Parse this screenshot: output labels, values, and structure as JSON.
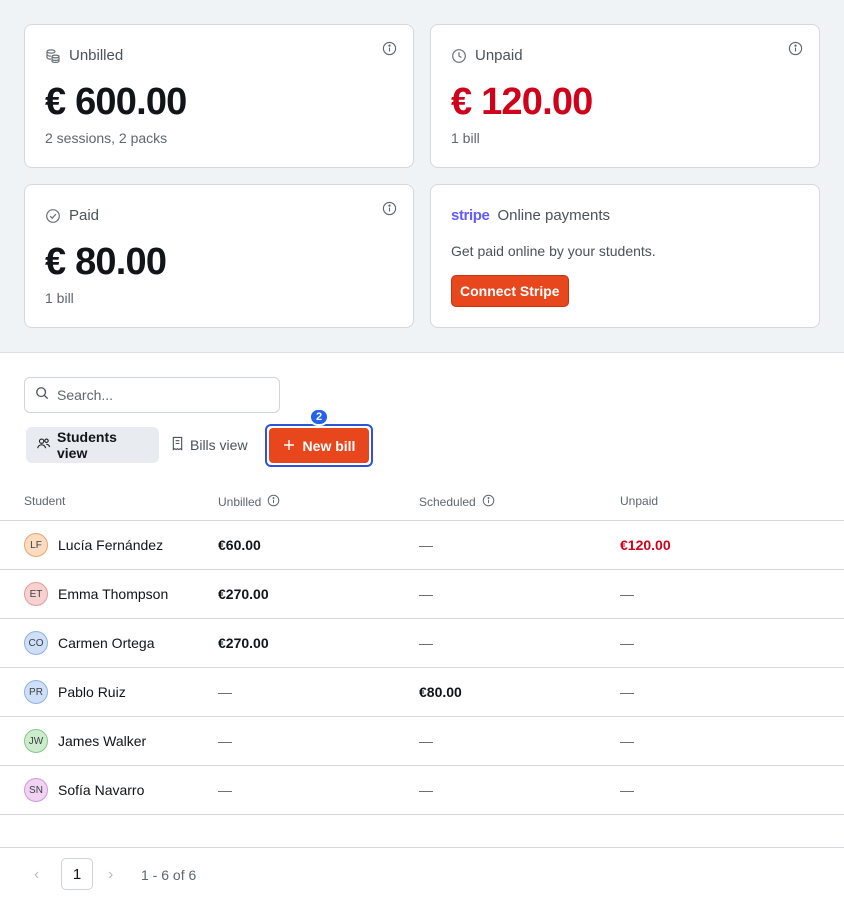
{
  "cards": {
    "unbilled": {
      "label": "Unbilled",
      "amount": "€ 600.00",
      "sub": "2 sessions, 2 packs"
    },
    "unpaid": {
      "label": "Unpaid",
      "amount": "€ 120.00",
      "sub": "1 bill"
    },
    "paid": {
      "label": "Paid",
      "amount": "€ 80.00",
      "sub": "1 bill"
    },
    "stripe": {
      "logo": "stripe",
      "label": "Online payments",
      "description": "Get paid online by your students.",
      "button": "Connect Stripe"
    }
  },
  "search": {
    "placeholder": "Search..."
  },
  "views": {
    "students": "Students view",
    "bills": "Bills view"
  },
  "new_bill": {
    "label": "New bill",
    "badge": "2"
  },
  "table": {
    "headers": {
      "student": "Student",
      "unbilled": "Unbilled",
      "scheduled": "Scheduled",
      "unpaid": "Unpaid"
    },
    "rows": [
      {
        "initials": "LF",
        "name": "Lucía Fernández",
        "unbilled": "€60.00",
        "scheduled": "—",
        "unpaid": "€120.00"
      },
      {
        "initials": "ET",
        "name": "Emma Thompson",
        "unbilled": "€270.00",
        "scheduled": "—",
        "unpaid": "—"
      },
      {
        "initials": "CO",
        "name": "Carmen Ortega",
        "unbilled": "€270.00",
        "scheduled": "—",
        "unpaid": "—"
      },
      {
        "initials": "PR",
        "name": "Pablo Ruiz",
        "unbilled": "—",
        "scheduled": "€80.00",
        "unpaid": "—"
      },
      {
        "initials": "JW",
        "name": "James Walker",
        "unbilled": "—",
        "scheduled": "—",
        "unpaid": "—"
      },
      {
        "initials": "SN",
        "name": "Sofía Navarro",
        "unbilled": "—",
        "scheduled": "—",
        "unpaid": "—"
      }
    ]
  },
  "pagination": {
    "page": "1",
    "range": "1 - 6 of 6"
  },
  "colors": {
    "accent": "#e8461c",
    "danger": "#d0021b",
    "focus_ring": "#2b55d6",
    "stripe": "#635bff",
    "avatars": [
      "#fbdcc0",
      "#f7d0d0",
      "#cfdff8",
      "#cfdff8",
      "#cdeccd",
      "#f0d3f2"
    ],
    "avatar_borders": [
      "#e9a66a",
      "#e39b9b",
      "#8fb0e3",
      "#8fb0e3",
      "#86c886",
      "#d197d6"
    ]
  }
}
